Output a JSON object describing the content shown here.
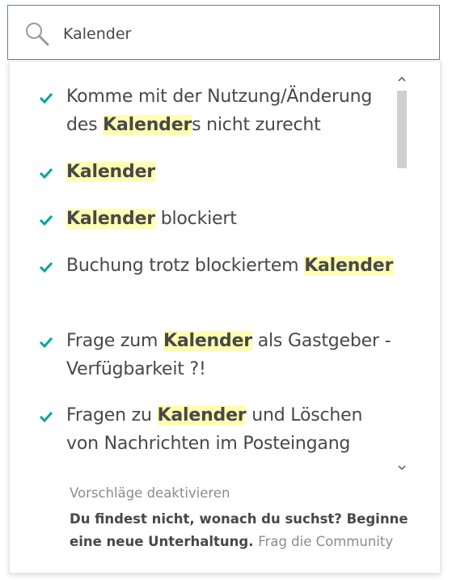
{
  "search": {
    "value": "Kalender"
  },
  "suggestions": [
    {
      "pre": "Komme mit der Nutzung/Änderung des ",
      "match": "Kalender",
      "post": "s nicht zurecht"
    },
    {
      "pre": "",
      "match": "Kalender",
      "post": ""
    },
    {
      "pre": "",
      "match": "Kalender",
      "post": " blockiert"
    },
    {
      "pre": "Buchung trotz blockiertem ",
      "match": "Kalender",
      "post": ""
    },
    {
      "pre": "Frage zum ",
      "match": "Kalender",
      "post": " als Gastgeber - Verfügbarkeit ?!"
    },
    {
      "pre": "Fragen zu ",
      "match": "Kalender",
      "post": " und Löschen von Nachrichten im Posteingang"
    }
  ],
  "footer": {
    "deactivate": "Vorschläge deaktivieren",
    "help_text": "Du findest nicht, wonach du suchst? Beginne eine neue Unterhaltung.",
    "help_link": "Frag die Community"
  },
  "colors": {
    "accent_border": "#3d8fab",
    "check": "#00a699",
    "highlight": "#ffffb3"
  }
}
